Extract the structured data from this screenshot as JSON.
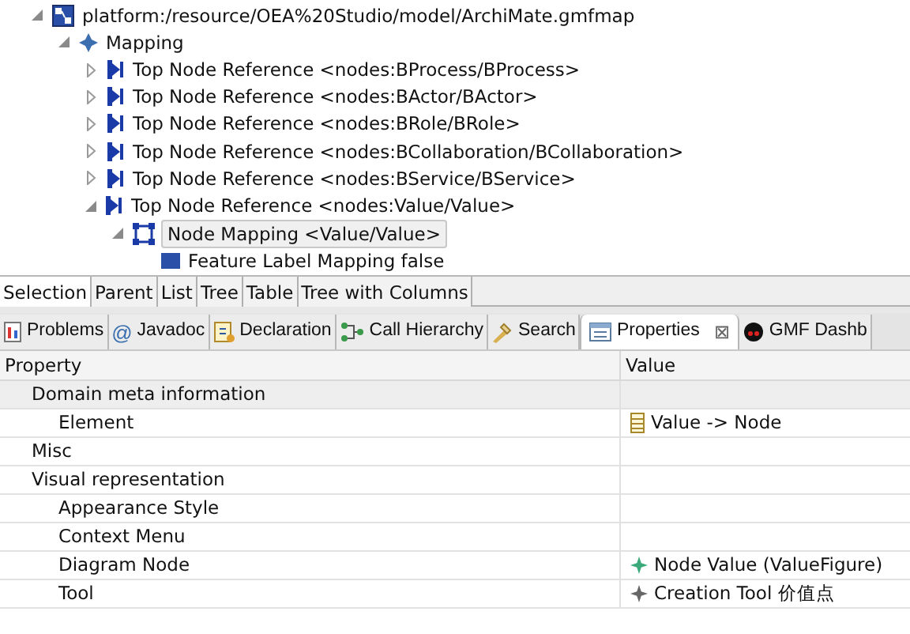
{
  "tree": [
    {
      "label": "platform:/resource/OEA%20Studio/model/ArchiMate.gmfmap",
      "kind": "file",
      "expanded": true,
      "selected": false,
      "children": [
        {
          "label": "Mapping",
          "kind": "mapping",
          "expanded": true,
          "selected": false,
          "children": [
            {
              "label": "Top Node Reference <nodes:BProcess/BProcess>",
              "kind": "ref",
              "expanded": false,
              "selected": false
            },
            {
              "label": "Top Node Reference <nodes:BActor/BActor>",
              "kind": "ref",
              "expanded": false,
              "selected": false
            },
            {
              "label": "Top Node Reference <nodes:BRole/BRole>",
              "kind": "ref",
              "expanded": false,
              "selected": false
            },
            {
              "label": "Top Node Reference <nodes:BCollaboration/BCollaboration>",
              "kind": "ref",
              "expanded": false,
              "selected": false
            },
            {
              "label": "Top Node Reference <nodes:BService/BService>",
              "kind": "ref",
              "expanded": false,
              "selected": false
            },
            {
              "label": "Top Node Reference <nodes:Value/Value>",
              "kind": "ref",
              "expanded": true,
              "selected": false,
              "children": [
                {
                  "label": "Node Mapping <Value/Value>",
                  "kind": "node",
                  "expanded": true,
                  "selected": true,
                  "children": [
                    {
                      "label": "Feature Label Mapping false",
                      "kind": "label",
                      "selected": false
                    }
                  ]
                }
              ]
            }
          ]
        }
      ]
    }
  ],
  "viewer_tabs": [
    {
      "label": "Selection",
      "selected": true
    },
    {
      "label": "Parent",
      "selected": false
    },
    {
      "label": "List",
      "selected": false
    },
    {
      "label": "Tree",
      "selected": false
    },
    {
      "label": "Table",
      "selected": false
    },
    {
      "label": "Tree with Columns",
      "selected": false
    }
  ],
  "view_tabs": [
    {
      "label": "Problems",
      "kind": "problems",
      "selected": false
    },
    {
      "label": "Javadoc",
      "kind": "javadoc",
      "glyph": "@",
      "selected": false
    },
    {
      "label": "Declaration",
      "kind": "declaration",
      "selected": false
    },
    {
      "label": "Call Hierarchy",
      "kind": "hierarchy",
      "selected": false
    },
    {
      "label": "Search",
      "kind": "search",
      "selected": false
    },
    {
      "label": "Properties",
      "kind": "properties",
      "selected": true,
      "close": "⊠"
    },
    {
      "label": "GMF Dashb",
      "kind": "dashboard",
      "selected": false
    }
  ],
  "table": {
    "columns": [
      "Property",
      "Value"
    ],
    "rows": [
      {
        "kind": "category",
        "property": "Domain meta information",
        "selected": true
      },
      {
        "kind": "property",
        "property": "Element",
        "value": "Value -> Node",
        "selected": false
      },
      {
        "kind": "category",
        "property": "Misc",
        "selected": false
      },
      {
        "kind": "category",
        "property": "Visual representation",
        "selected": false
      },
      {
        "kind": "property",
        "property": "Appearance Style",
        "selected": false
      },
      {
        "kind": "property",
        "property": "Context Menu",
        "selected": false
      },
      {
        "kind": "property",
        "property": "Diagram Node",
        "value": "Node Value (ValueFigure)",
        "selected": false
      },
      {
        "kind": "property",
        "property": "Tool",
        "value": "Creation Tool 价值点",
        "selected": false
      }
    ]
  }
}
